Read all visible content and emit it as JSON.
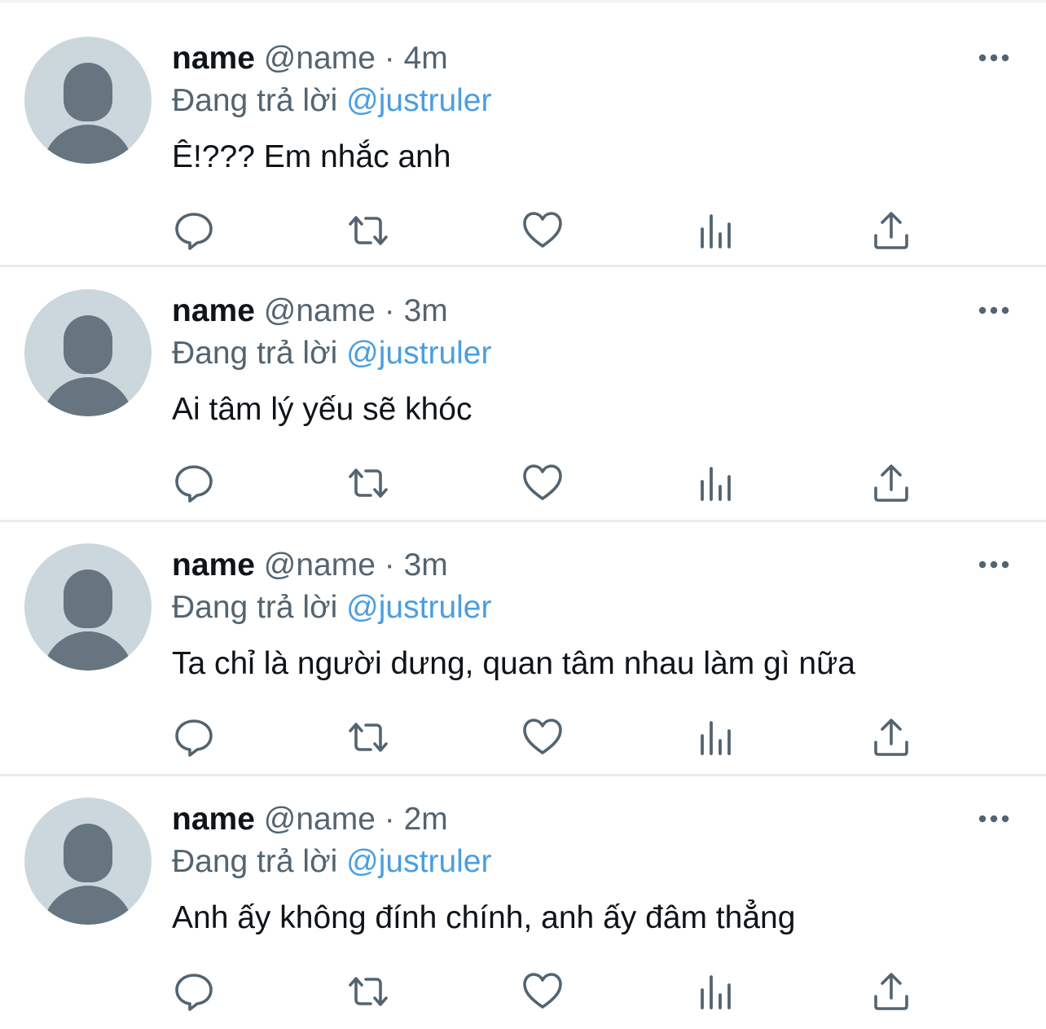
{
  "tweets": [
    {
      "name": "name",
      "handle": "@name",
      "separator": "·",
      "time": "4m",
      "reply_prefix": "Đang trả lời",
      "reply_to": "@justruler",
      "text": "Ê!??? Em nhắc anh"
    },
    {
      "name": "name",
      "handle": "@name",
      "separator": "·",
      "time": "3m",
      "reply_prefix": "Đang trả lời",
      "reply_to": "@justruler",
      "text": "Ai tâm lý yếu sẽ khóc"
    },
    {
      "name": "name",
      "handle": "@name",
      "separator": "·",
      "time": "3m",
      "reply_prefix": "Đang trả lời",
      "reply_to": "@justruler",
      "text": "Ta chỉ là người dưng, quan tâm nhau làm gì nữa"
    },
    {
      "name": "name",
      "handle": "@name",
      "separator": "·",
      "time": "2m",
      "reply_prefix": "Đang trả lời",
      "reply_to": "@justruler",
      "text": "Anh ấy không đính chính, anh ấy đâm thẳng"
    }
  ],
  "icons": {
    "avatar": "default-avatar-icon",
    "more": "more-options-icon",
    "reply": "reply-icon",
    "retweet": "retweet-icon",
    "like": "like-icon",
    "views": "views-icon",
    "share": "share-icon"
  },
  "colors": {
    "text": "#0f1419",
    "secondary": "#536471",
    "mention": "#4b9ee0",
    "divider": "#e6ecf0",
    "avatar_bg": "#ccd6dd",
    "avatar_fg": "#66757f"
  }
}
